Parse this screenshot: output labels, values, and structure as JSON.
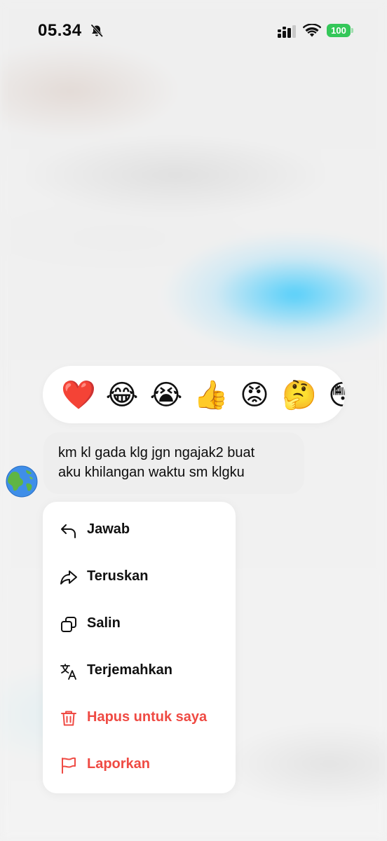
{
  "status_bar": {
    "time": "05.34",
    "battery": "100"
  },
  "reactions": [
    {
      "icon": "red-heart",
      "glyph": "❤️"
    },
    {
      "icon": "tears-of-joy",
      "glyph": "😂"
    },
    {
      "icon": "loudly-crying",
      "glyph": "😭"
    },
    {
      "icon": "thumbs-up",
      "glyph": "👍"
    },
    {
      "icon": "angry-face",
      "glyph": "😡"
    },
    {
      "icon": "thinking-face",
      "glyph": "🤔"
    },
    {
      "icon": "astonished-face",
      "glyph": "😳"
    }
  ],
  "message": {
    "avatar_icon": "globe-americas",
    "line1": "km kl gada klg jgn ngajak2 buat",
    "line2": "aku khilangan waktu sm klgku"
  },
  "menu": {
    "reply": "Jawab",
    "forward": "Teruskan",
    "copy": "Salin",
    "translate": "Terjemahkan",
    "delete": "Hapus untuk saya",
    "report": "Laporkan"
  },
  "colors": {
    "danger": "#ef4a43",
    "battery": "#34c759",
    "bubble": "#eeeeee"
  }
}
